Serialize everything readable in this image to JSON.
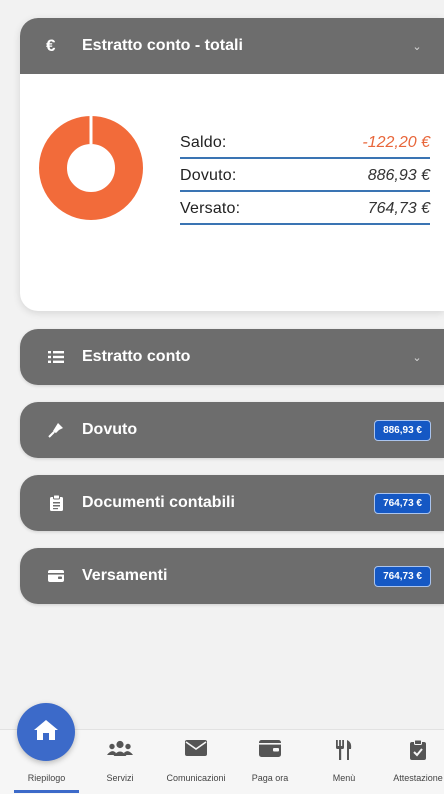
{
  "summary": {
    "title": "Estratto conto - totali",
    "rows": [
      {
        "label": "Saldo:",
        "value": "-122,20 €",
        "negative": true
      },
      {
        "label": "Dovuto:",
        "value": "886,93 €"
      },
      {
        "label": "Versato:",
        "value": "764,73 €"
      }
    ],
    "donut_color": "#f26b3a"
  },
  "sections": {
    "estratto": {
      "label": "Estratto conto",
      "icon": "list-icon"
    },
    "dovuto": {
      "label": "Dovuto",
      "badge": "886,93 €",
      "icon": "pin-icon"
    },
    "documenti": {
      "label": "Documenti contabili",
      "badge": "764,73 €",
      "icon": "clipboard-icon"
    },
    "versamenti": {
      "label": "Versamenti",
      "badge": "764,73 €",
      "icon": "wallet-icon"
    }
  },
  "nav": {
    "items": [
      {
        "label": "Riepilogo",
        "icon": "home-icon",
        "active": true
      },
      {
        "label": "Servizi",
        "icon": "users-icon"
      },
      {
        "label": "Comunicazioni",
        "icon": "envelope-icon"
      },
      {
        "label": "Paga ora",
        "icon": "wallet-icon"
      },
      {
        "label": "Menù",
        "icon": "utensils-icon"
      },
      {
        "label": "Attestazione",
        "icon": "clipboard-check-icon"
      }
    ]
  },
  "colors": {
    "header": "#6d6d6d",
    "accent": "#3c6ac9",
    "badge": "#1558c4",
    "negative": "#e8663a"
  }
}
